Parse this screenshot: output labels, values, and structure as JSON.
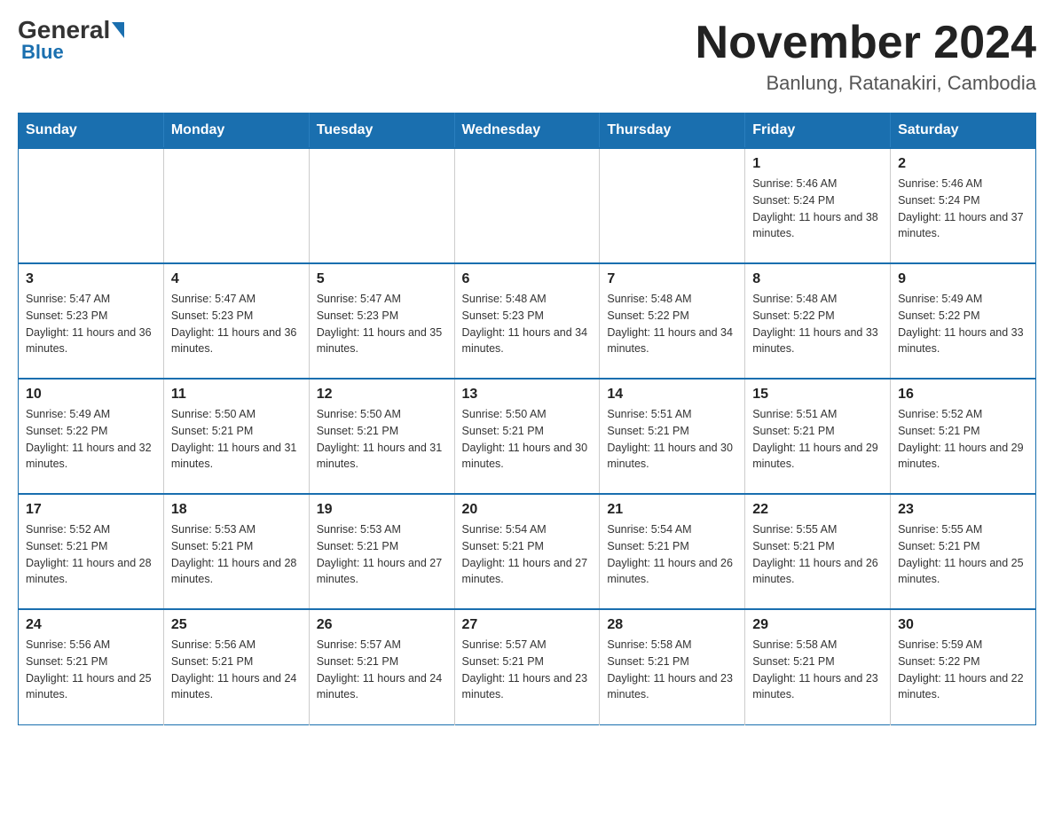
{
  "header": {
    "logo": {
      "general": "General",
      "blue": "Blue"
    },
    "title": "November 2024",
    "location": "Banlung, Ratanakiri, Cambodia"
  },
  "days_of_week": [
    "Sunday",
    "Monday",
    "Tuesday",
    "Wednesday",
    "Thursday",
    "Friday",
    "Saturday"
  ],
  "weeks": [
    [
      {
        "day": "",
        "info": ""
      },
      {
        "day": "",
        "info": ""
      },
      {
        "day": "",
        "info": ""
      },
      {
        "day": "",
        "info": ""
      },
      {
        "day": "",
        "info": ""
      },
      {
        "day": "1",
        "info": "Sunrise: 5:46 AM\nSunset: 5:24 PM\nDaylight: 11 hours and 38 minutes."
      },
      {
        "day": "2",
        "info": "Sunrise: 5:46 AM\nSunset: 5:24 PM\nDaylight: 11 hours and 37 minutes."
      }
    ],
    [
      {
        "day": "3",
        "info": "Sunrise: 5:47 AM\nSunset: 5:23 PM\nDaylight: 11 hours and 36 minutes."
      },
      {
        "day": "4",
        "info": "Sunrise: 5:47 AM\nSunset: 5:23 PM\nDaylight: 11 hours and 36 minutes."
      },
      {
        "day": "5",
        "info": "Sunrise: 5:47 AM\nSunset: 5:23 PM\nDaylight: 11 hours and 35 minutes."
      },
      {
        "day": "6",
        "info": "Sunrise: 5:48 AM\nSunset: 5:23 PM\nDaylight: 11 hours and 34 minutes."
      },
      {
        "day": "7",
        "info": "Sunrise: 5:48 AM\nSunset: 5:22 PM\nDaylight: 11 hours and 34 minutes."
      },
      {
        "day": "8",
        "info": "Sunrise: 5:48 AM\nSunset: 5:22 PM\nDaylight: 11 hours and 33 minutes."
      },
      {
        "day": "9",
        "info": "Sunrise: 5:49 AM\nSunset: 5:22 PM\nDaylight: 11 hours and 33 minutes."
      }
    ],
    [
      {
        "day": "10",
        "info": "Sunrise: 5:49 AM\nSunset: 5:22 PM\nDaylight: 11 hours and 32 minutes."
      },
      {
        "day": "11",
        "info": "Sunrise: 5:50 AM\nSunset: 5:21 PM\nDaylight: 11 hours and 31 minutes."
      },
      {
        "day": "12",
        "info": "Sunrise: 5:50 AM\nSunset: 5:21 PM\nDaylight: 11 hours and 31 minutes."
      },
      {
        "day": "13",
        "info": "Sunrise: 5:50 AM\nSunset: 5:21 PM\nDaylight: 11 hours and 30 minutes."
      },
      {
        "day": "14",
        "info": "Sunrise: 5:51 AM\nSunset: 5:21 PM\nDaylight: 11 hours and 30 minutes."
      },
      {
        "day": "15",
        "info": "Sunrise: 5:51 AM\nSunset: 5:21 PM\nDaylight: 11 hours and 29 minutes."
      },
      {
        "day": "16",
        "info": "Sunrise: 5:52 AM\nSunset: 5:21 PM\nDaylight: 11 hours and 29 minutes."
      }
    ],
    [
      {
        "day": "17",
        "info": "Sunrise: 5:52 AM\nSunset: 5:21 PM\nDaylight: 11 hours and 28 minutes."
      },
      {
        "day": "18",
        "info": "Sunrise: 5:53 AM\nSunset: 5:21 PM\nDaylight: 11 hours and 28 minutes."
      },
      {
        "day": "19",
        "info": "Sunrise: 5:53 AM\nSunset: 5:21 PM\nDaylight: 11 hours and 27 minutes."
      },
      {
        "day": "20",
        "info": "Sunrise: 5:54 AM\nSunset: 5:21 PM\nDaylight: 11 hours and 27 minutes."
      },
      {
        "day": "21",
        "info": "Sunrise: 5:54 AM\nSunset: 5:21 PM\nDaylight: 11 hours and 26 minutes."
      },
      {
        "day": "22",
        "info": "Sunrise: 5:55 AM\nSunset: 5:21 PM\nDaylight: 11 hours and 26 minutes."
      },
      {
        "day": "23",
        "info": "Sunrise: 5:55 AM\nSunset: 5:21 PM\nDaylight: 11 hours and 25 minutes."
      }
    ],
    [
      {
        "day": "24",
        "info": "Sunrise: 5:56 AM\nSunset: 5:21 PM\nDaylight: 11 hours and 25 minutes."
      },
      {
        "day": "25",
        "info": "Sunrise: 5:56 AM\nSunset: 5:21 PM\nDaylight: 11 hours and 24 minutes."
      },
      {
        "day": "26",
        "info": "Sunrise: 5:57 AM\nSunset: 5:21 PM\nDaylight: 11 hours and 24 minutes."
      },
      {
        "day": "27",
        "info": "Sunrise: 5:57 AM\nSunset: 5:21 PM\nDaylight: 11 hours and 23 minutes."
      },
      {
        "day": "28",
        "info": "Sunrise: 5:58 AM\nSunset: 5:21 PM\nDaylight: 11 hours and 23 minutes."
      },
      {
        "day": "29",
        "info": "Sunrise: 5:58 AM\nSunset: 5:21 PM\nDaylight: 11 hours and 23 minutes."
      },
      {
        "day": "30",
        "info": "Sunrise: 5:59 AM\nSunset: 5:22 PM\nDaylight: 11 hours and 22 minutes."
      }
    ]
  ]
}
